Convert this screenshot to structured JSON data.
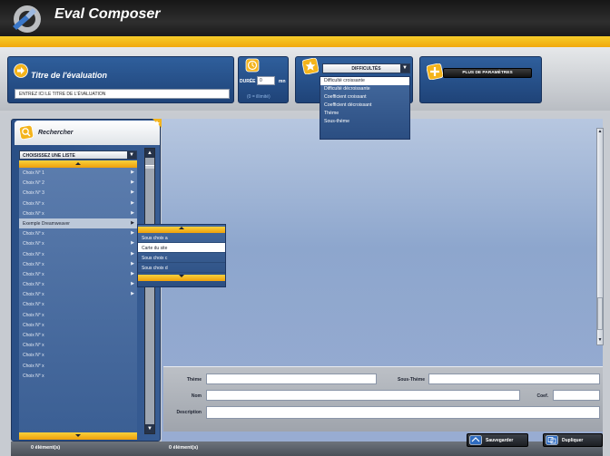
{
  "app": {
    "title": "Eval Composer"
  },
  "evaluation": {
    "heading": "Titre de l'évaluation",
    "title_placeholder": "ENTREZ ICI LE TITRE DE L'ÉVALUATION"
  },
  "duree": {
    "label": "DURÉE",
    "value": "0",
    "unit": "mn",
    "hint": "(0 = illimité)"
  },
  "difficultes": {
    "label": "DIFFICULTÉS",
    "options": [
      "Difficulté croissante",
      "Difficulté décroissante",
      "Coefficient croissant",
      "Coefficient décroissant",
      "Thème",
      "Sous-thème"
    ],
    "selected_index": 0
  },
  "params": {
    "button_label": "PLUS DE PARAMÈTRES"
  },
  "search": {
    "label": "Rechercher",
    "list_select": "CHOISISSEZ UNE LISTE",
    "items": [
      {
        "label": "Choix N° 1",
        "has_sub": true
      },
      {
        "label": "Choix N° 2",
        "has_sub": true
      },
      {
        "label": "Choix N° 3",
        "has_sub": true
      },
      {
        "label": "Choix N° x",
        "has_sub": true
      },
      {
        "label": "Choix N° x",
        "has_sub": true
      },
      {
        "label": "Exemple Dreamweaver",
        "has_sub": true
      },
      {
        "label": "Choix N° x",
        "has_sub": true
      },
      {
        "label": "Choix N° x",
        "has_sub": true
      },
      {
        "label": "Choix N° x",
        "has_sub": true
      },
      {
        "label": "Choix N° x",
        "has_sub": true
      },
      {
        "label": "Choix N° x",
        "has_sub": true
      },
      {
        "label": "Choix N° x",
        "has_sub": true
      },
      {
        "label": "Choix N° x",
        "has_sub": true
      },
      {
        "label": "Choix N° x",
        "has_sub": false
      },
      {
        "label": "Choix N° x",
        "has_sub": false
      },
      {
        "label": "Choix N° x",
        "has_sub": false
      },
      {
        "label": "Choix N° x",
        "has_sub": false
      },
      {
        "label": "Choix N° x",
        "has_sub": false
      },
      {
        "label": "Choix N° x",
        "has_sub": false
      },
      {
        "label": "Choix N° x",
        "has_sub": false
      },
      {
        "label": "Choix N° x",
        "has_sub": false
      }
    ],
    "highlighted_index": 5
  },
  "submenu": {
    "items": [
      "Sous choix a",
      "Carte du site",
      "Sous choix c",
      "Sous choix d"
    ],
    "selected_index": 1
  },
  "form": {
    "theme_label": "Thème",
    "sous_theme_label": "Sous-Thème",
    "nom_label": "Nom",
    "coef_label": "Coef.",
    "description_label": "Description"
  },
  "footer": {
    "left_count": "0 élément(s)",
    "main_count": "0 élément(s)",
    "save_label": "Sauvegarder",
    "duplicate_label": "Dupliquer"
  },
  "colors": {
    "accent_gold": "#f3b51a",
    "panel_blue": "#2f5f9c",
    "titlebar": "#1e1e1e"
  }
}
